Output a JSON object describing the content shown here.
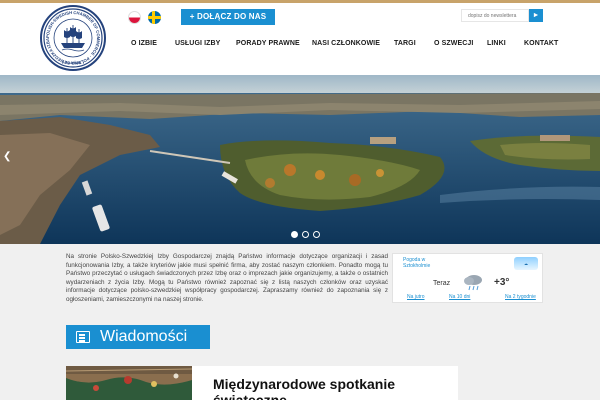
{
  "header": {
    "logo_alt": "Polish-Swedish Chamber of Commerce Gdańsk",
    "languages": [
      "pl",
      "se"
    ],
    "join_label": "+ DOŁĄCZ DO NAS",
    "newsletter_placeholder": "dopisz do newslettera",
    "newsletter_button": "►"
  },
  "nav": {
    "items": [
      "O IZBIE",
      "USŁUGI IZBY",
      "PORADY PRAWNE",
      "NASI CZŁONKOWIE",
      "TARGI",
      "O SZWECJI",
      "LINKI",
      "KONTAKT"
    ]
  },
  "hero": {
    "slide_count": 3,
    "active_slide": 1,
    "prev_arrow": "❮"
  },
  "intro": {
    "text": "Na stronie Polsko-Szwedzkiej Izby Gospodarczej znajdą Państwo informacje dotyczące organizacji i zasad funkcjonowania Izby, a także kryteriów jakie musi spełnić firma, aby zostać naszym członkiem. Ponadto mogą tu Państwo przeczytać o usługach świadczonych przez Izbę oraz o imprezach jakie organizujemy, a także o ostatnich wydarzeniach z życia Izby. Mogą tu Państwo również zapoznać się z listą naszych członków oraz uzyskać informacje dotyczące polsko-szwedzkiej współpracy gospodarczej. Zapraszamy również do zapoznania się z ogłoszeniami, zamieszczonymi na naszej stronie."
  },
  "weather": {
    "title": "Pogoda w Sztokholmie",
    "now_label": "Teraz",
    "temperature": "+3°",
    "links": [
      "Na jutro",
      "Na 10 dni",
      "Na 2 tygodnie"
    ],
    "icon": "cloud-rain-icon"
  },
  "news": {
    "heading": "Wiadomości",
    "first_title": "Międzynarodowe spotkanie świąteczne"
  },
  "colors": {
    "accent": "#1a8fd1",
    "brand_navy": "#25437d",
    "top_bar": "#c8a36a"
  }
}
